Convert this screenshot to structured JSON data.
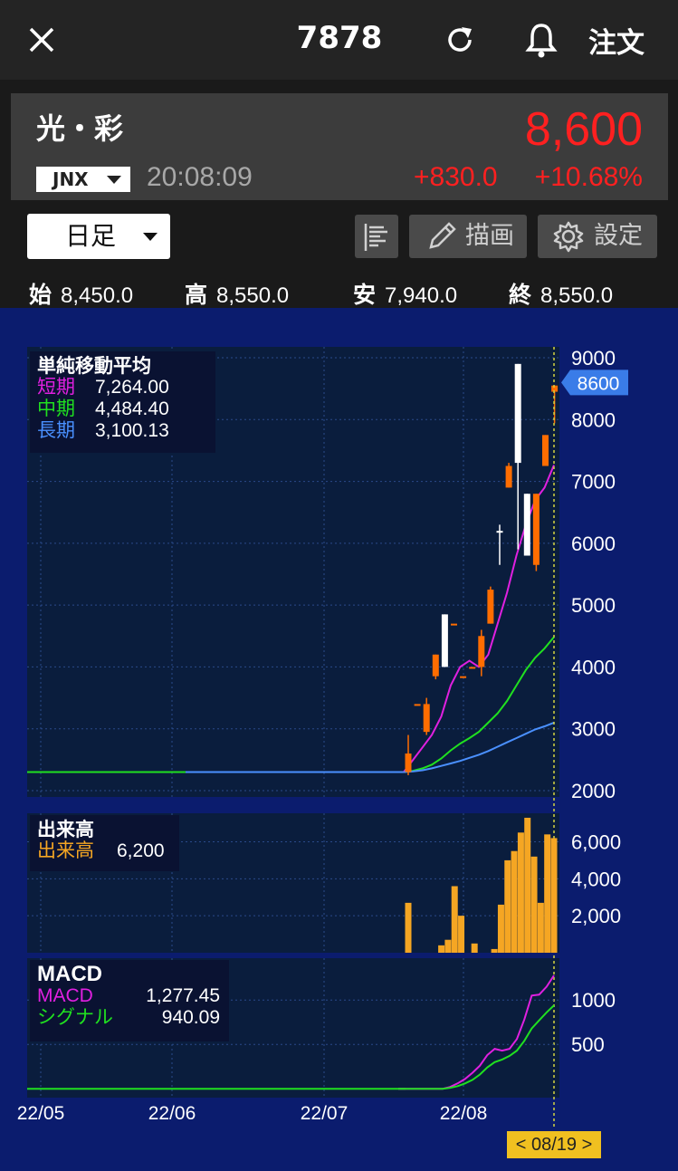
{
  "header": {
    "stock_code": "7878",
    "order_label": "注文"
  },
  "quote": {
    "name": "光・彩",
    "price": "8,600",
    "market": "JNX",
    "time": "20:08:09",
    "change": "+830.0",
    "change_pct": "+10.68%"
  },
  "toolbar": {
    "period": "日足",
    "draw_label": "描画",
    "settings_label": "設定"
  },
  "ohlc": {
    "open_label": "始",
    "open": "8,450.0",
    "high_label": "高",
    "high": "8,550.0",
    "low_label": "安",
    "low": "7,940.0",
    "close_label": "終",
    "close": "8,550.0"
  },
  "colors": {
    "up": "#ff6d00",
    "down": "#ffffff",
    "short_ma": "#e020e0",
    "mid_ma": "#20e020",
    "long_ma": "#4a90ff",
    "volume": "#f5a623",
    "price_up": "#ff2020"
  },
  "legends": {
    "ma": {
      "title": "単純移動平均",
      "short_label": "短期",
      "short_value": "7,264.00",
      "mid_label": "中期",
      "mid_value": "4,484.40",
      "long_label": "長期",
      "long_value": "3,100.13"
    },
    "volume": {
      "title": "出来高",
      "label": "出来高",
      "value": "6,200"
    },
    "macd": {
      "title": "MACD",
      "macd_label": "MACD",
      "macd_value": "1,277.45",
      "signal_label": "シグナル",
      "signal_value": "940.09"
    }
  },
  "current_price_tag": "8600",
  "date_cursor": "< 08/19 >",
  "chart_data": [
    {
      "type": "candlestick",
      "title": "単純移動平均",
      "x": [
        "22/05",
        "22/06",
        "22/07",
        "22/08"
      ],
      "ylim": [
        2000,
        9000
      ],
      "yticks": [
        2000,
        3000,
        4000,
        5000,
        6000,
        7000,
        8000,
        9000
      ],
      "flat_price_before_listing": 2300,
      "candles": [
        {
          "o": 2300,
          "h": 2900,
          "l": 2250,
          "c": 2600,
          "up": true
        },
        {
          "o": 3400,
          "h": 3400,
          "l": 3400,
          "c": 3400,
          "up": true
        },
        {
          "o": 2950,
          "h": 3500,
          "l": 2900,
          "c": 3400,
          "up": true
        },
        {
          "o": 3850,
          "h": 4200,
          "l": 3800,
          "c": 4200,
          "up": true
        },
        {
          "o": 4850,
          "h": 4850,
          "l": 4000,
          "c": 4000,
          "up": false
        },
        {
          "o": 4700,
          "h": 4700,
          "l": 4700,
          "c": 4700,
          "up": true
        },
        {
          "o": 3850,
          "h": 3850,
          "l": 3850,
          "c": 3850,
          "up": true
        },
        {
          "o": 4000,
          "h": 4000,
          "l": 4000,
          "c": 4000,
          "up": true
        },
        {
          "o": 4000,
          "h": 4600,
          "l": 3850,
          "c": 4500,
          "up": true
        },
        {
          "o": 4700,
          "h": 5300,
          "l": 4700,
          "c": 5250,
          "up": true
        },
        {
          "o": 6200,
          "h": 6300,
          "l": 5650,
          "c": 6200,
          "up": false
        },
        {
          "o": 6900,
          "h": 7300,
          "l": 6900,
          "c": 7250,
          "up": true
        },
        {
          "o": 8900,
          "h": 8900,
          "l": 5900,
          "c": 7300,
          "up": false
        },
        {
          "o": 6800,
          "h": 6800,
          "l": 5800,
          "c": 5800,
          "up": false
        },
        {
          "o": 5650,
          "h": 6800,
          "l": 5550,
          "c": 6800,
          "up": true
        },
        {
          "o": 7250,
          "h": 7750,
          "l": 7250,
          "c": 7750,
          "up": true
        },
        {
          "o": 8450,
          "h": 8550,
          "l": 7940,
          "c": 8550,
          "up": true
        }
      ],
      "series": [
        {
          "name": "短期",
          "values": [
            2300,
            2500,
            2700,
            2900,
            3200,
            3700,
            4000,
            4100,
            4000,
            4200,
            4700,
            5200,
            5800,
            6300,
            6700,
            6900,
            7264
          ]
        },
        {
          "name": "中期",
          "values": [
            2300,
            2320,
            2360,
            2420,
            2520,
            2650,
            2760,
            2850,
            2950,
            3100,
            3250,
            3450,
            3700,
            3950,
            4150,
            4300,
            4484
          ]
        },
        {
          "name": "長期",
          "values": [
            2300,
            2310,
            2330,
            2360,
            2400,
            2440,
            2480,
            2530,
            2580,
            2640,
            2710,
            2780,
            2850,
            2920,
            2990,
            3040,
            3100
          ]
        }
      ]
    },
    {
      "type": "bar",
      "title": "出来高",
      "ylim": [
        0,
        7200
      ],
      "yticks": [
        2000,
        4000,
        6000
      ],
      "values": [
        2700,
        0,
        0,
        0,
        0,
        400,
        700,
        3600,
        2000,
        0,
        500,
        0,
        0,
        200,
        2600,
        5000,
        5500,
        6500,
        7300,
        5200,
        2700,
        6400,
        6200
      ]
    },
    {
      "type": "line",
      "title": "MACD",
      "ylim": [
        -100,
        1400
      ],
      "yticks": [
        500,
        1000
      ],
      "series": [
        {
          "name": "MACD",
          "values": [
            0,
            0,
            0,
            0,
            0,
            0,
            0,
            20,
            60,
            110,
            180,
            260,
            380,
            450,
            430,
            450,
            560,
            780,
            1050,
            1060,
            1150,
            1277
          ]
        },
        {
          "name": "シグナル",
          "values": [
            0,
            0,
            0,
            0,
            0,
            0,
            0,
            10,
            30,
            60,
            100,
            160,
            240,
            300,
            330,
            370,
            430,
            540,
            680,
            770,
            860,
            940
          ]
        }
      ]
    }
  ]
}
